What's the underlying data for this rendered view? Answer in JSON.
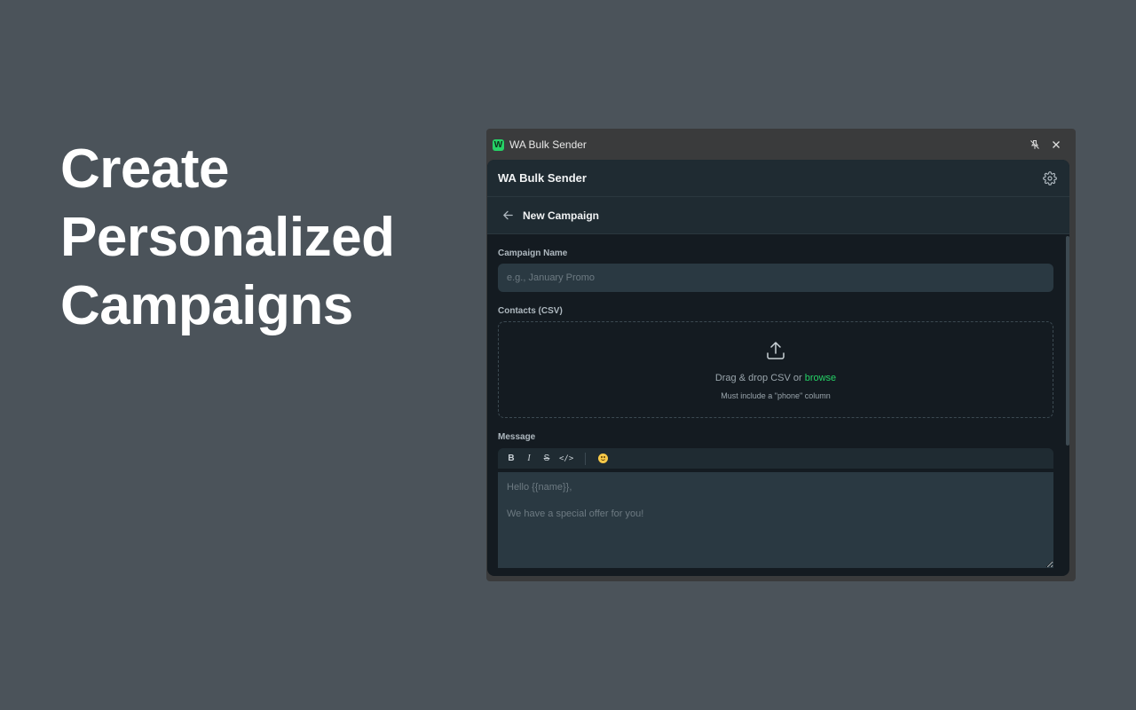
{
  "headline": {
    "line1": "Create",
    "line2": "Personalized",
    "line3": "Campaigns"
  },
  "window": {
    "title": "WA Bulk Sender",
    "logo_letter": "W",
    "pin_icon": "pin-off-icon",
    "close_icon": "close-icon"
  },
  "app": {
    "brand": "WA Bulk Sender",
    "settings_icon": "gear-icon",
    "page_title": "New Campaign"
  },
  "form": {
    "campaign_name_label": "Campaign Name",
    "campaign_name_placeholder": "e.g., January Promo",
    "campaign_name_value": "",
    "contacts_label": "Contacts (CSV)",
    "dropzone_text": "Drag & drop CSV or ",
    "dropzone_link": "browse",
    "dropzone_hint": "Must include a \"phone\" column",
    "message_label": "Message",
    "toolbar": {
      "bold": "B",
      "italic": "I",
      "strike": "S",
      "code": "</>"
    },
    "message_placeholder": "Hello {{name}},\n\nWe have a special offer for you!",
    "message_value": ""
  },
  "colors": {
    "background": "#4b535a",
    "accent": "#25d366",
    "panel": "#141b21",
    "header": "#1f2b32",
    "input": "#2a3942"
  }
}
